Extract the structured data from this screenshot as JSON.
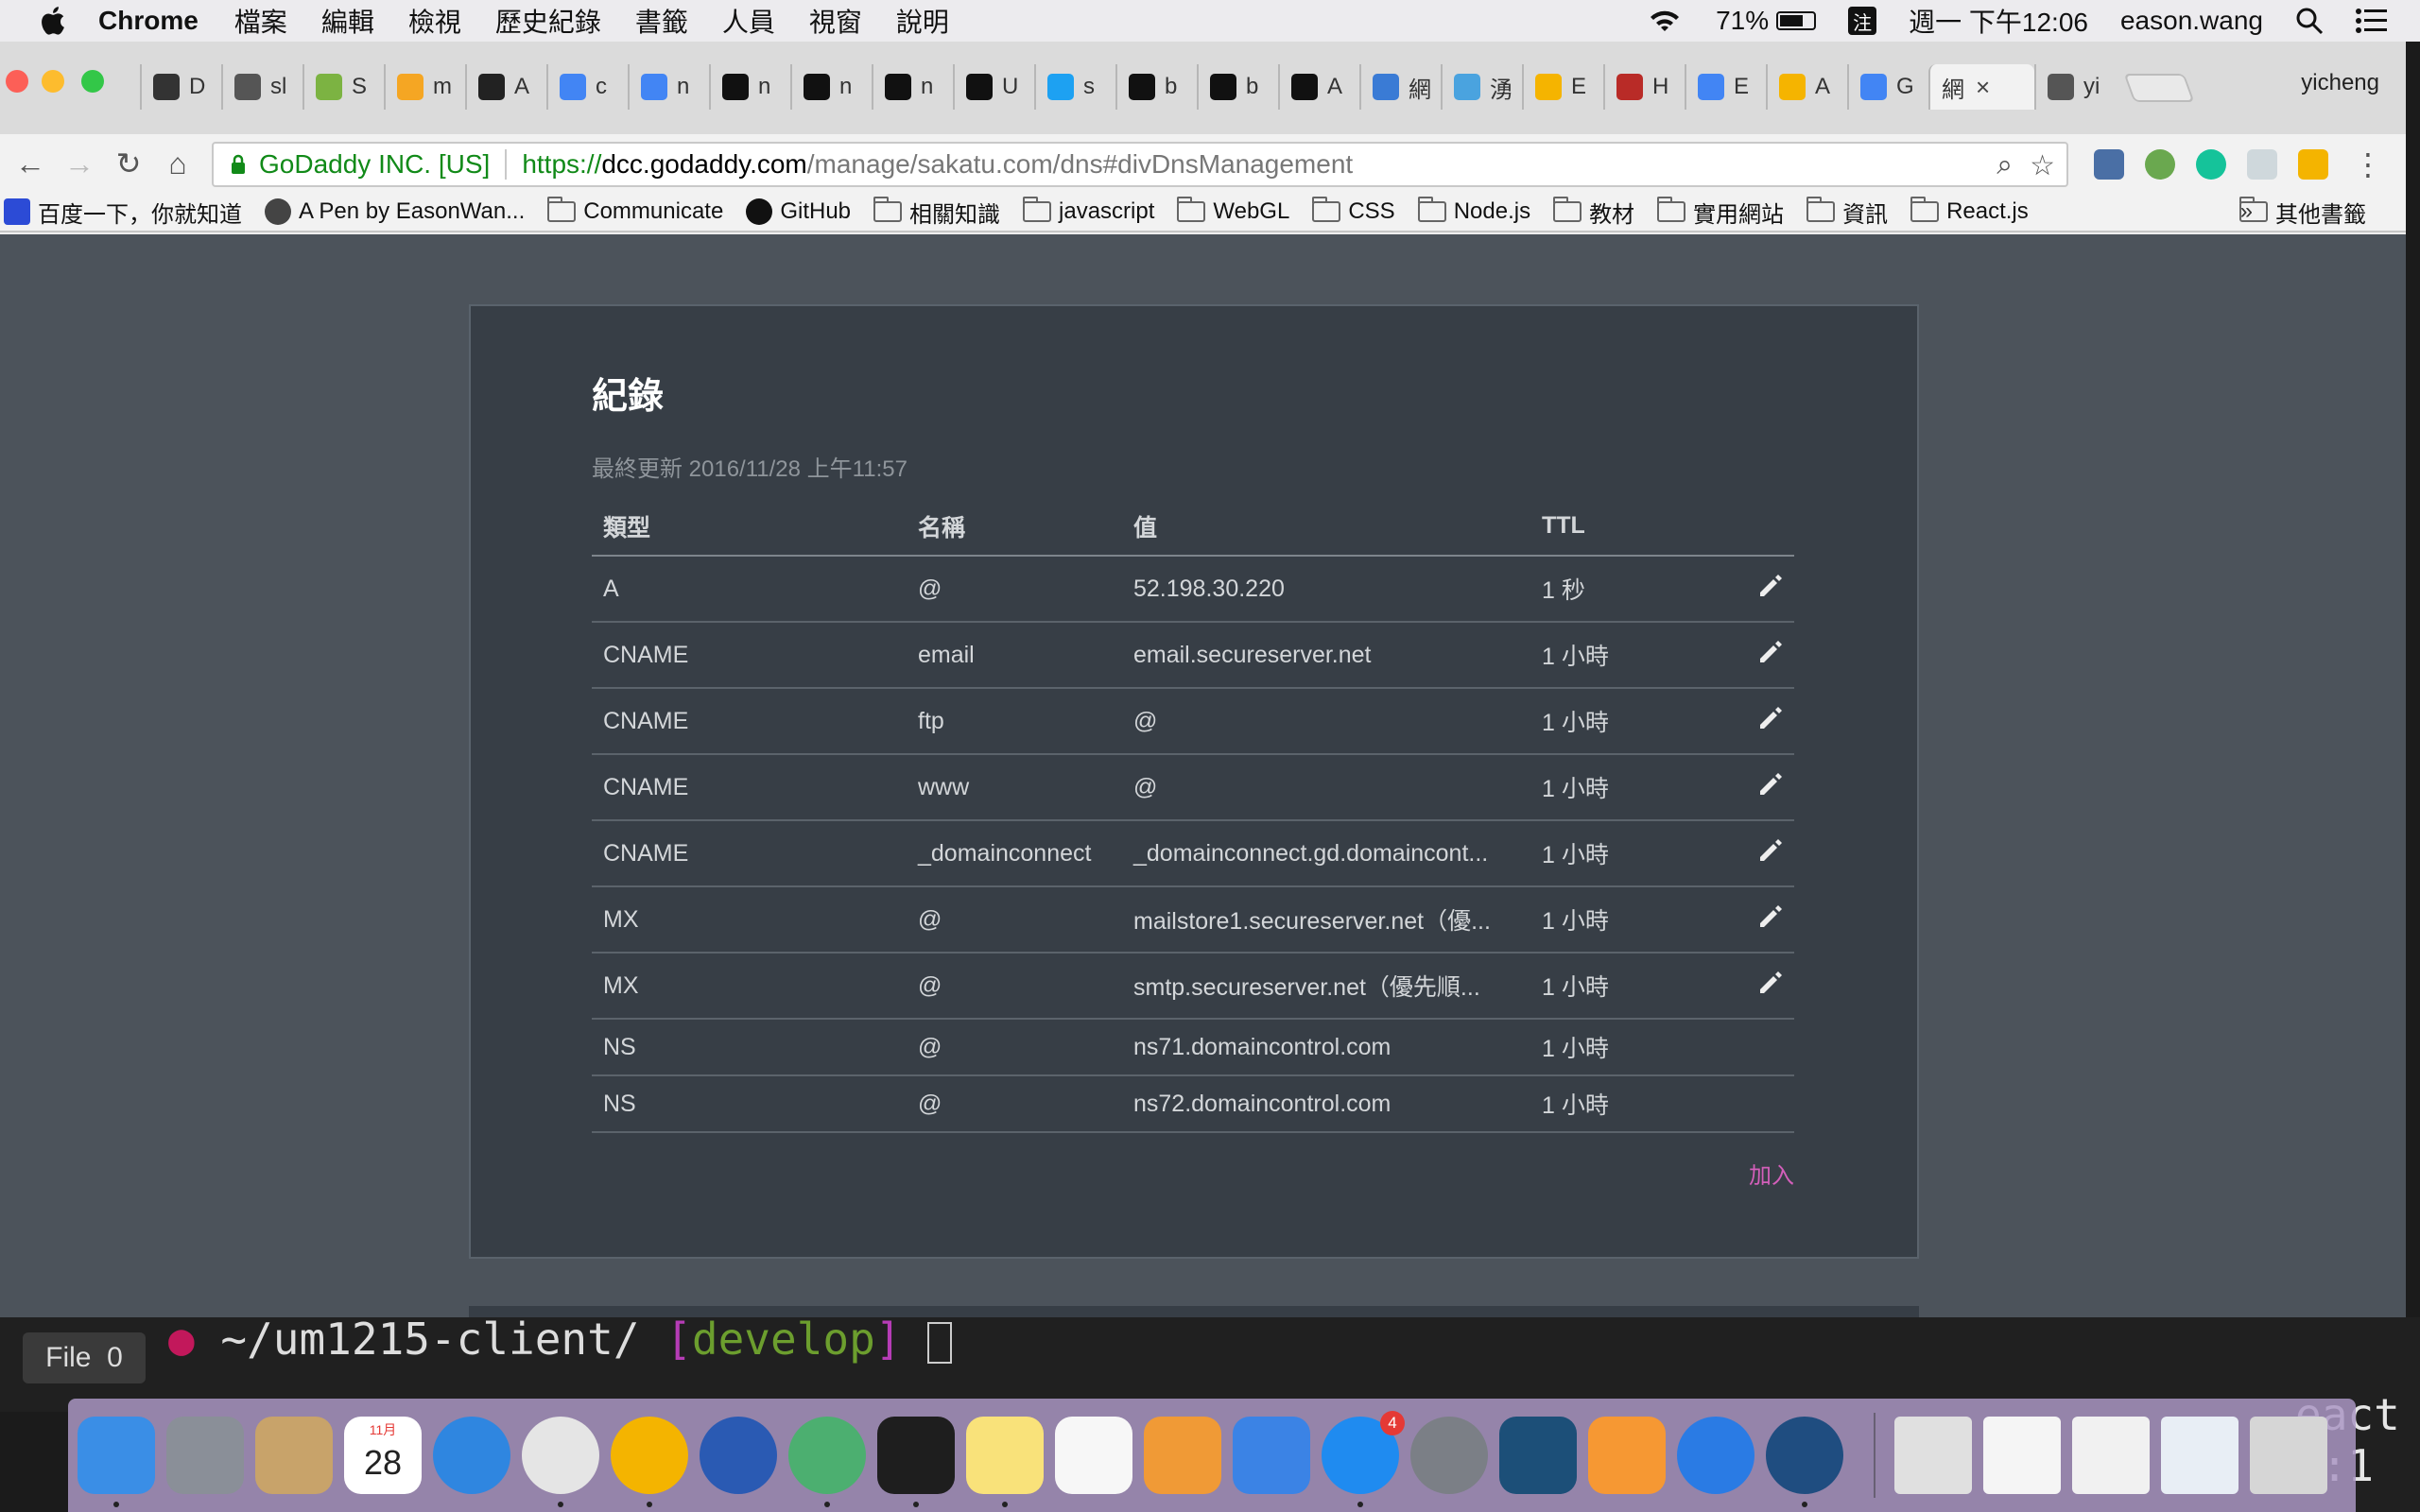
{
  "menubar": {
    "app": "Chrome",
    "menus": [
      "檔案",
      "編輯",
      "檢視",
      "歷史紀錄",
      "書籤",
      "人員",
      "視窗",
      "說明"
    ],
    "battery": "71%",
    "battery_fraction": 0.71,
    "ime": "注",
    "clock": "週一 下午12:06",
    "user": "eason.wang"
  },
  "tabs": [
    {
      "label": "D",
      "color": "#333333"
    },
    {
      "label": "sl",
      "color": "#555555"
    },
    {
      "label": "S",
      "color": "#7cb342"
    },
    {
      "label": "m",
      "color": "#f5a623"
    },
    {
      "label": "A",
      "color": "#222222"
    },
    {
      "label": "c",
      "color": "#4285f4"
    },
    {
      "label": "n",
      "color": "#4285f4"
    },
    {
      "label": "n",
      "color": "#111111"
    },
    {
      "label": "n",
      "color": "#111111"
    },
    {
      "label": "n",
      "color": "#111111"
    },
    {
      "label": "U",
      "color": "#111111"
    },
    {
      "label": "s",
      "color": "#1da1f2"
    },
    {
      "label": "b",
      "color": "#111111"
    },
    {
      "label": "b",
      "color": "#111111"
    },
    {
      "label": "A",
      "color": "#111111"
    },
    {
      "label": "網",
      "color": "#3a7bd5"
    },
    {
      "label": "湧",
      "color": "#4aa3df"
    },
    {
      "label": "E",
      "color": "#f5b400"
    },
    {
      "label": "H",
      "color": "#b92b27"
    },
    {
      "label": "E",
      "color": "#4285f4"
    },
    {
      "label": "A",
      "color": "#f5b400"
    },
    {
      "label": "G",
      "color": "#4285f4"
    }
  ],
  "active_tab": {
    "label": "網",
    "close": "×"
  },
  "after_tab": {
    "label": "yi"
  },
  "profile": "yicheng",
  "omnibox": {
    "ev_name": "GoDaddy INC. [US]",
    "scheme": "https://",
    "host": "dcc.godaddy.com",
    "path": "/manage/sakatu.com/dns#divDnsManagement"
  },
  "bookmarks": [
    {
      "label": "百度一下，你就知道",
      "icon": "paw-icon"
    },
    {
      "label": "A Pen by EasonWan...",
      "icon": "codepen-icon"
    },
    {
      "label": "Communicate",
      "icon": "folder-icon"
    },
    {
      "label": "GitHub",
      "icon": "github-icon"
    },
    {
      "label": "相關知識",
      "icon": "folder-icon"
    },
    {
      "label": "javascript",
      "icon": "folder-icon"
    },
    {
      "label": "WebGL",
      "icon": "folder-icon"
    },
    {
      "label": "CSS",
      "icon": "folder-icon"
    },
    {
      "label": "Node.js",
      "icon": "folder-icon"
    },
    {
      "label": "教材",
      "icon": "folder-icon"
    },
    {
      "label": "實用網站",
      "icon": "folder-icon"
    },
    {
      "label": "資訊",
      "icon": "folder-icon"
    },
    {
      "label": "React.js",
      "icon": "folder-icon"
    }
  ],
  "bookmarks_more": "»",
  "bookmarks_other": "其他書籤",
  "dns": {
    "title": "紀錄",
    "updated": "最終更新 2016/11/28 上午11:57",
    "columns": [
      "類型",
      "名稱",
      "值",
      "TTL"
    ],
    "rows": [
      {
        "type": "A",
        "name": "@",
        "value": "52.198.30.220",
        "ttl": "1 秒",
        "editable": true
      },
      {
        "type": "CNAME",
        "name": "email",
        "value": "email.secureserver.net",
        "ttl": "1 小時",
        "editable": true
      },
      {
        "type": "CNAME",
        "name": "ftp",
        "value": "@",
        "ttl": "1 小時",
        "editable": true
      },
      {
        "type": "CNAME",
        "name": "www",
        "value": "@",
        "ttl": "1 小時",
        "editable": true
      },
      {
        "type": "CNAME",
        "name": "_domainconnect",
        "value": "_domainconnect.gd.domaincont...",
        "ttl": "1 小時",
        "editable": true
      },
      {
        "type": "MX",
        "name": "@",
        "value": "mailstore1.secureserver.net（優...",
        "ttl": "1 小時",
        "editable": true
      },
      {
        "type": "MX",
        "name": "@",
        "value": "smtp.secureserver.net（優先順...",
        "ttl": "1 小時",
        "editable": true
      },
      {
        "type": "NS",
        "name": "@",
        "value": "ns71.domaincontrol.com",
        "ttl": "1 小時",
        "editable": false
      },
      {
        "type": "NS",
        "name": "@",
        "value": "ns72.domaincontrol.com",
        "ttl": "1 小時",
        "editable": false
      }
    ],
    "add_label": "加入",
    "accent": "#d35fba"
  },
  "terminal": {
    "path": "~/um1215-client/",
    "branch_open": "[",
    "branch": "develop",
    "branch_close": "]",
    "file_label": "File",
    "file_count": "0"
  },
  "right_edge_text": [
    "eact",
    "s:1"
  ],
  "dock": {
    "calendar_month": "11月",
    "calendar_day": "28",
    "appstore_badge": "4",
    "apps": [
      {
        "name": "finder",
        "color": "#3a8ee6",
        "running": true
      },
      {
        "name": "launchpad",
        "color": "#8a8f98",
        "running": false
      },
      {
        "name": "preview",
        "color": "#c8a36a",
        "running": false
      },
      {
        "name": "calendar",
        "color": "#ffffff",
        "running": false
      },
      {
        "name": "safari",
        "color": "#2f86e0",
        "running": false
      },
      {
        "name": "chrome",
        "color": "#e5e5e5",
        "running": true
      },
      {
        "name": "chrome-canary",
        "color": "#f4b400",
        "running": true
      },
      {
        "name": "firefox",
        "color": "#2a5ab3",
        "running": false
      },
      {
        "name": "atom",
        "color": "#4caf70",
        "running": true
      },
      {
        "name": "terminal",
        "color": "#1e1e1e",
        "running": true
      },
      {
        "name": "notes",
        "color": "#f9e27a",
        "running": true
      },
      {
        "name": "reminders",
        "color": "#f7f7f7",
        "running": false
      },
      {
        "name": "pages",
        "color": "#f09a36",
        "running": false
      },
      {
        "name": "keynote",
        "color": "#3b83e5",
        "running": false
      },
      {
        "name": "app-store",
        "color": "#1f8bf0",
        "running": true
      },
      {
        "name": "system-preferences",
        "color": "#7b7f86",
        "running": false
      },
      {
        "name": "mysql-workbench",
        "color": "#1c4f78",
        "running": false
      },
      {
        "name": "zeplin",
        "color": "#f69833",
        "running": false
      },
      {
        "name": "quicktime",
        "color": "#2a7be4",
        "running": false
      },
      {
        "name": "sourcetree",
        "color": "#1f4d80",
        "running": true
      }
    ],
    "docs": [
      {
        "name": "document-stack",
        "color": "#e0e0e0"
      },
      {
        "name": "downloads",
        "color": "#f5f5f5"
      },
      {
        "name": "appstore-window",
        "color": "#f1f1f1"
      },
      {
        "name": "screenshot",
        "color": "#e8eef5"
      },
      {
        "name": "trash",
        "color": "#d6d6d6"
      }
    ]
  }
}
